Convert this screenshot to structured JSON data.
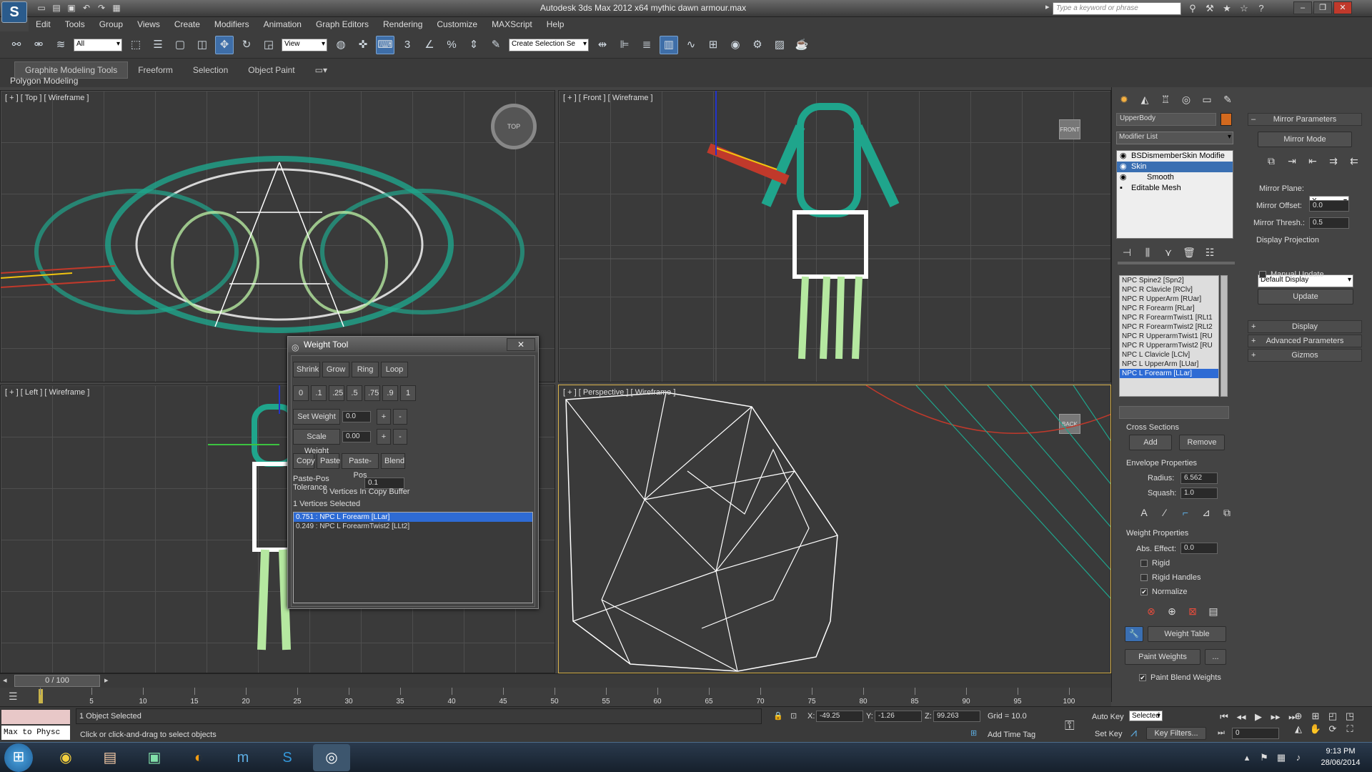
{
  "titlebar": {
    "title": "Autodesk 3ds Max  2012 x64      mythic dawn armour.max",
    "search_placeholder": "Type a keyword or phrase",
    "quick_access": [
      "new-file-icon",
      "open-file-icon",
      "save-icon",
      "undo-icon",
      "redo-icon",
      "project-folder-icon"
    ]
  },
  "menu": [
    "Edit",
    "Tools",
    "Group",
    "Views",
    "Create",
    "Modifiers",
    "Animation",
    "Graph Editors",
    "Rendering",
    "Customize",
    "MAXScript",
    "Help"
  ],
  "toolbar": {
    "filter": "All",
    "ref_coord": "View",
    "selection_set": "Create Selection Se"
  },
  "ribbon": {
    "tabs": [
      "Graphite Modeling Tools",
      "Freeform",
      "Selection",
      "Object Paint"
    ],
    "sub_label": "Polygon Modeling"
  },
  "viewports": {
    "top": "[ + ] [ Top ] [ Wireframe ]",
    "front": "[ + ] [ Front ] [ Wireframe ]",
    "left": "[ + ] [ Left ] [ Wireframe ]",
    "persp": "[ + ] [ Perspective ] [ Wireframe ]",
    "cube_top": "TOP",
    "cube_front": "FRONT",
    "cube_back": "BACK"
  },
  "weight_tool": {
    "title": "Weight Tool",
    "row1": [
      "Shrink",
      "Grow",
      "Ring",
      "Loop"
    ],
    "presets": [
      "0",
      ".1",
      ".25",
      ".5",
      ".75",
      ".9",
      "1"
    ],
    "set_weight_label": "Set Weight",
    "set_weight_value": "0.0",
    "scale_weight_label": "Scale Weight",
    "scale_weight_value": "0.00",
    "plus": "+",
    "minus": "-",
    "row_copy": [
      "Copy",
      "Paste",
      "Paste-Pos",
      "Blend"
    ],
    "tolerance_label": "Paste-Pos Tolerance",
    "tolerance_value": "0.1",
    "copy_buffer": "0 Vertices In Copy Buffer",
    "vertices_selected": "1 Vertices Selected",
    "weights": [
      "0.751 : NPC L Forearm [LLar]",
      "0.249 : NPC L ForearmTwist2 [LLt2]"
    ]
  },
  "command_panel": {
    "object_name": "UpperBody",
    "object_color": "#d2691e",
    "modifier_list": "Modifier List",
    "stack": [
      "BSDismemberSkin Modifie",
      "Skin",
      "Smooth",
      "Editable Mesh"
    ],
    "bones": [
      "NPC Spine2 [Spn2]",
      "NPC R Clavicle [RClv]",
      "NPC R UpperArm [RUar]",
      "NPC R Forearm [RLar]",
      "NPC R ForearmTwist1 [RLt1",
      "NPC R ForearmTwist2 [RLt2",
      "NPC R UpperarmTwist1 [RU",
      "NPC R UpperarmTwist2 [RU",
      "NPC L Clavicle [LClv]",
      "NPC L UpperArm [LUar]",
      "NPC L Forearm [LLar]"
    ],
    "cross_sections": "Cross Sections",
    "add": "Add",
    "remove": "Remove",
    "envelope_props": "Envelope Properties",
    "radius_label": "Radius:",
    "radius": "6.562",
    "squash_label": "Squash:",
    "squash": "1.0",
    "weight_props": "Weight Properties",
    "abs_effect_label": "Abs. Effect:",
    "abs_effect": "0.0",
    "rigid": "Rigid",
    "rigid_handles": "Rigid Handles",
    "normalize": "Normalize",
    "weight_table": "Weight Table",
    "paint_weights": "Paint Weights",
    "ellipsis": "...",
    "paint_blend": "Paint Blend Weights"
  },
  "mirror": {
    "title": "Mirror Parameters",
    "mode": "Mirror Mode",
    "plane_label": "Mirror Plane:",
    "plane": "X",
    "offset_label": "Mirror Offset:",
    "offset": "0.0",
    "thresh_label": "Mirror Thresh.:",
    "thresh": "0.5",
    "display_projection": "Display Projection",
    "projection": "Default Display",
    "manual_update": "Manual Update",
    "update": "Update",
    "rollouts": [
      "Display",
      "Advanced Parameters",
      "Gizmos"
    ]
  },
  "timeline": {
    "frame": "0 / 100",
    "ticks": [
      "0",
      "5",
      "10",
      "15",
      "20",
      "25",
      "30",
      "35",
      "40",
      "45",
      "50",
      "55",
      "60",
      "65",
      "70",
      "75",
      "80",
      "85",
      "90",
      "95",
      "100"
    ]
  },
  "status": {
    "maxscript": "Max to Physc",
    "selected": "1 Object Selected",
    "prompt": "Click or click-and-drag to select objects",
    "x_label": "X:",
    "x": "-49.25",
    "y_label": "Y:",
    "y": "-1.26",
    "z_label": "Z:",
    "z": "99.263",
    "grid": "Grid = 10.0",
    "add_time_tag": "Add Time Tag",
    "auto_key": "Auto Key",
    "set_key": "Set Key",
    "key_mode": "Selected",
    "key_filters": "Key Filters...",
    "frame_field": "0"
  },
  "taskbar": {
    "time": "9:13 PM",
    "date": "28/06/2014"
  },
  "colors": {
    "accent": "#3a6fb2",
    "mesh_teal": "#1fa58c",
    "mesh_green": "#b5e8a0"
  }
}
